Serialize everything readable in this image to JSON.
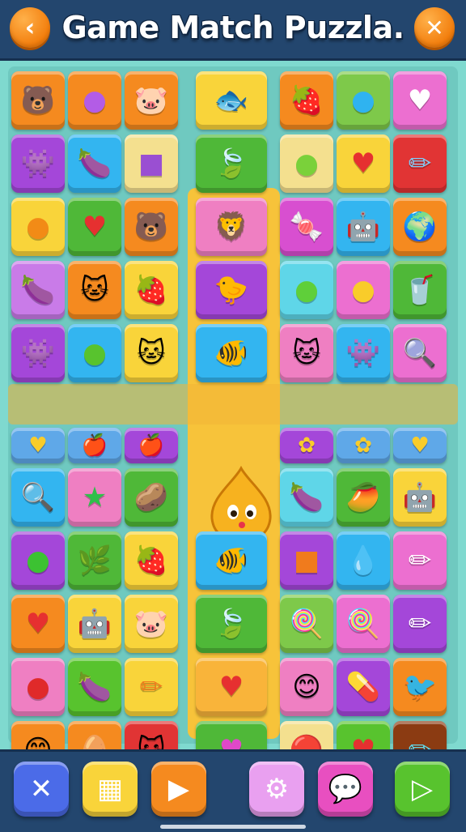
{
  "header": {
    "title": "Game Match Puzzla.",
    "back_icon": "chevron-left-icon",
    "close_icon": "close-icon"
  },
  "colors": {
    "bar": "#23466e",
    "board": "#6fc9c0",
    "lane": "#f7c33a",
    "accent_orange": "#f27d0c"
  },
  "board": {
    "rows": [
      [
        {
          "icon": "bear-face",
          "glyph": "🐻",
          "color": "#f58a1f"
        },
        {
          "icon": "purple-ball",
          "glyph": "●",
          "color": "#f58a1f",
          "gcolor": "#b35ce6"
        },
        {
          "icon": "pig-face",
          "glyph": "🐷",
          "color": "#f58a1f"
        },
        {
          "icon": "orange-fish",
          "glyph": "🐟",
          "color": "#f9d43a"
        },
        {
          "icon": "strawberry-face",
          "glyph": "🍓",
          "color": "#f58a1f"
        },
        {
          "icon": "blue-ball",
          "glyph": "●",
          "color": "#7ec94a",
          "gcolor": "#2fb3f0"
        },
        {
          "icon": "heart",
          "glyph": "♥",
          "color": "#ec6fd0",
          "gcolor": "#ffffff"
        }
      ],
      [
        {
          "icon": "purple-monster",
          "glyph": "👾",
          "color": "#a447d9"
        },
        {
          "icon": "purple-plum",
          "glyph": "🍆",
          "color": "#33b5f0"
        },
        {
          "icon": "purple-block",
          "glyph": "■",
          "color": "#f4e08f",
          "gcolor": "#9a4fd2"
        },
        {
          "icon": "green-leaf",
          "glyph": "🍃",
          "color": "#4fb838"
        },
        {
          "icon": "green-lime",
          "glyph": "●",
          "color": "#f4e08f",
          "gcolor": "#7ad13a"
        },
        {
          "icon": "red-heart",
          "glyph": "♥",
          "color": "#f9d43a",
          "gcolor": "#e63030"
        },
        {
          "icon": "crayon",
          "glyph": "✏",
          "color": "#e13434",
          "gcolor": "#7ecbf5"
        }
      ],
      [
        {
          "icon": "orange-ball",
          "glyph": "●",
          "color": "#f9d43a",
          "gcolor": "#f28b16"
        },
        {
          "icon": "red-heart",
          "glyph": "♥",
          "color": "#4fb838",
          "gcolor": "#e63030"
        },
        {
          "icon": "bear-face",
          "glyph": "🐻",
          "color": "#f58a1f"
        },
        {
          "icon": "orange-lion",
          "glyph": "🦁",
          "color": "#ef7fc2"
        },
        {
          "icon": "candy",
          "glyph": "🍬",
          "color": "#d84fd0"
        },
        {
          "icon": "robot-block",
          "glyph": "🤖",
          "color": "#33b5f0"
        },
        {
          "icon": "planet",
          "glyph": "🌍",
          "color": "#f58a1f"
        }
      ],
      [
        {
          "icon": "purple-plum",
          "glyph": "🍆",
          "color": "#c97be8"
        },
        {
          "icon": "cat-face",
          "glyph": "🐱",
          "color": "#f58a1f"
        },
        {
          "icon": "strawberry",
          "glyph": "🍓",
          "color": "#f9d43a"
        },
        {
          "icon": "yellow-bird",
          "glyph": "🐤",
          "color": "#a447d9"
        },
        {
          "icon": "green-egg",
          "glyph": "●",
          "color": "#5fd6e8",
          "gcolor": "#5fcf3a"
        },
        {
          "icon": "yellow-balloon",
          "glyph": "●",
          "color": "#ec6fd0",
          "gcolor": "#f9cc2a"
        },
        {
          "icon": "cup",
          "glyph": "🥤",
          "color": "#4fb838"
        }
      ],
      [
        {
          "icon": "purple-monster",
          "glyph": "👾",
          "color": "#a447d9"
        },
        {
          "icon": "green-egg",
          "glyph": "●",
          "color": "#33b5f0",
          "gcolor": "#58c32e"
        },
        {
          "icon": "cat-face",
          "glyph": "🐱",
          "color": "#f9d43a"
        },
        {
          "icon": "orange-fish",
          "glyph": "🐠",
          "color": "#33b5f0"
        },
        {
          "icon": "cat-face",
          "glyph": "🐱",
          "color": "#ef7fc2"
        },
        {
          "icon": "purple-monster",
          "glyph": "👾",
          "color": "#33b5f0"
        },
        {
          "icon": "magnifier",
          "glyph": "🔍",
          "color": "#ec6fd0"
        }
      ],
      [
        {
          "icon": "yellow-heart",
          "glyph": "♥",
          "color": "#5fa8e8",
          "gcolor": "#f9cc2a"
        },
        {
          "icon": "yellow-apple",
          "glyph": "🍎",
          "color": "#5fa8e8"
        },
        {
          "icon": "yellow-apple",
          "glyph": "🍎",
          "color": "#a447d9"
        },
        {
          "icon": "mascot",
          "glyph": "",
          "color": "#f9d43a"
        },
        {
          "icon": "yellow-flower",
          "glyph": "✿",
          "color": "#a447d9",
          "gcolor": "#f9cc2a"
        },
        {
          "icon": "yellow-flower",
          "glyph": "✿",
          "color": "#5fa8e8",
          "gcolor": "#f9cc2a"
        },
        {
          "icon": "yellow-heart",
          "glyph": "♥",
          "color": "#5fa8e8",
          "gcolor": "#f9cc2a"
        }
      ],
      [
        {
          "icon": "magnifier",
          "glyph": "🔍",
          "color": "#33b5f0"
        },
        {
          "icon": "green-star",
          "glyph": "★",
          "color": "#ef7fc2",
          "gcolor": "#2fbf4a"
        },
        {
          "icon": "potato-face",
          "glyph": "🥔",
          "color": "#4fb838"
        },
        {
          "icon": "empty",
          "glyph": "",
          "color": "#f9d43a"
        },
        {
          "icon": "purple-plum",
          "glyph": "🍆",
          "color": "#5fd6e8"
        },
        {
          "icon": "mango-face",
          "glyph": "🥭",
          "color": "#4fb838"
        },
        {
          "icon": "robot-block",
          "glyph": "🤖",
          "color": "#f9d43a"
        }
      ],
      [
        {
          "icon": "green-egg",
          "glyph": "●",
          "color": "#a447d9",
          "gcolor": "#3cc232"
        },
        {
          "icon": "plant",
          "glyph": "🌿",
          "color": "#4fb838"
        },
        {
          "icon": "strawberry",
          "glyph": "🍓",
          "color": "#f9d43a"
        },
        {
          "icon": "orange-fish",
          "glyph": "🐠",
          "color": "#33b5f0"
        },
        {
          "icon": "orange-block",
          "glyph": "■",
          "color": "#a447d9",
          "gcolor": "#f07b1d"
        },
        {
          "icon": "blue-drop",
          "glyph": "💧",
          "color": "#33b5f0"
        },
        {
          "icon": "crayon",
          "glyph": "✏",
          "color": "#ec6fd0",
          "gcolor": "#ffffff"
        }
      ],
      [
        {
          "icon": "red-heart",
          "glyph": "♥",
          "color": "#f58a1f",
          "gcolor": "#e63030"
        },
        {
          "icon": "robot-block",
          "glyph": "🤖",
          "color": "#f9d43a"
        },
        {
          "icon": "pig-face",
          "glyph": "🐷",
          "color": "#f9d43a"
        },
        {
          "icon": "green-leaf",
          "glyph": "🍃",
          "color": "#4fb838"
        },
        {
          "icon": "red-popsicle",
          "glyph": "🍭",
          "color": "#7ec94a"
        },
        {
          "icon": "purple-lollipop",
          "glyph": "🍭",
          "color": "#ec6fd0"
        },
        {
          "icon": "crayon",
          "glyph": "✏",
          "color": "#a447d9",
          "gcolor": "#ffffff"
        }
      ],
      [
        {
          "icon": "red-ball",
          "glyph": "●",
          "color": "#ef7fc2",
          "gcolor": "#e02a2a"
        },
        {
          "icon": "purple-plum",
          "glyph": "🍆",
          "color": "#58c32e"
        },
        {
          "icon": "crayon",
          "glyph": "✏",
          "color": "#f9d43a",
          "gcolor": "#f07b1d"
        },
        {
          "icon": "red-heart",
          "glyph": "♥",
          "color": "#f9b43a",
          "gcolor": "#e63030"
        },
        {
          "icon": "orange-face",
          "glyph": "😊",
          "color": "#ef7fc2"
        },
        {
          "icon": "green-candy",
          "glyph": "💊",
          "color": "#a447d9"
        },
        {
          "icon": "orange-bird",
          "glyph": "🐦",
          "color": "#f58a1f"
        }
      ],
      [
        {
          "icon": "teal-face",
          "glyph": "😊",
          "color": "#f58a1f"
        },
        {
          "icon": "pink-egg",
          "glyph": "🥚",
          "color": "#f58a1f"
        },
        {
          "icon": "cat-face",
          "glyph": "🐱",
          "color": "#e13434"
        },
        {
          "icon": "pink-heart",
          "glyph": "♥",
          "color": "#4fb838",
          "gcolor": "#e048c8"
        },
        {
          "icon": "red-badge",
          "glyph": "🔴",
          "color": "#f4e08f"
        },
        {
          "icon": "red-heart",
          "glyph": "♥",
          "color": "#58c32e",
          "gcolor": "#e63030"
        },
        {
          "icon": "blue-crayon",
          "glyph": "✏",
          "color": "#8b3b12",
          "gcolor": "#5fd6e8"
        }
      ]
    ]
  },
  "bottom": {
    "buttons": [
      {
        "name": "shuffle-button",
        "icon": "shuffle-icon",
        "glyph": "✕",
        "color": "#4b6be8"
      },
      {
        "name": "grid-button",
        "icon": "grid-icon",
        "glyph": "▦",
        "color": "#f9d43a"
      },
      {
        "name": "play-button",
        "icon": "play-icon",
        "glyph": "▶",
        "color": "#f58a1f"
      },
      {
        "name": "settings-button",
        "icon": "gear-icon",
        "glyph": "⚙",
        "color": "#e9a0f0"
      },
      {
        "name": "chat-button",
        "icon": "chat-icon",
        "glyph": "💬",
        "color": "#e84fc0"
      },
      {
        "name": "next-button",
        "icon": "next-icon",
        "glyph": "▷",
        "color": "#58c32e"
      }
    ]
  }
}
